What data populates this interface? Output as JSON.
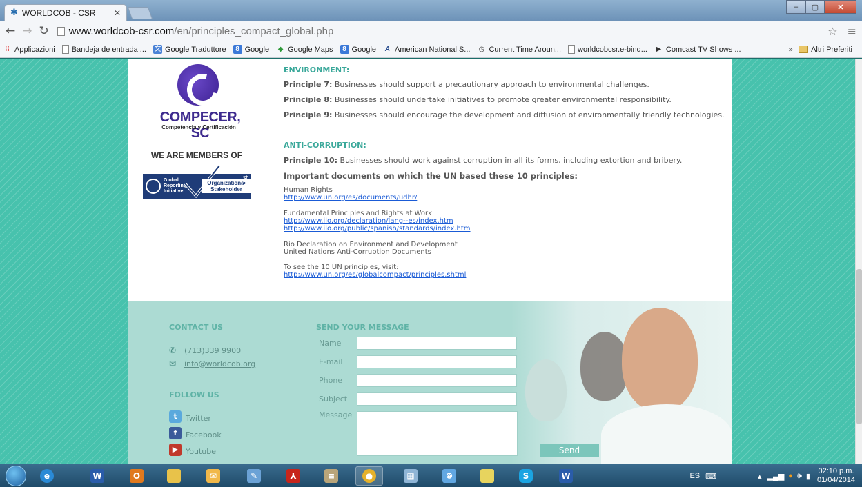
{
  "browser": {
    "tab_title": "WORLDCOB - CSR",
    "url_host": "www.worldcob-csr.com",
    "url_path": "/en/principles_compact_global.php",
    "bookmarks": [
      {
        "label": "Applicazioni",
        "icon": "apps-grid-icon"
      },
      {
        "label": "Bandeja de entrada ...",
        "icon": "page-icon"
      },
      {
        "label": "Google Traduttore",
        "icon": "translate-icon"
      },
      {
        "label": "Google",
        "icon": "google-icon"
      },
      {
        "label": "Google Maps",
        "icon": "maps-icon"
      },
      {
        "label": "Google",
        "icon": "google-icon"
      },
      {
        "label": "American National S...",
        "icon": "ans-icon"
      },
      {
        "label": "Current Time Aroun...",
        "icon": "clock-icon"
      },
      {
        "label": "worldcobcsr.e-bind...",
        "icon": "page-icon"
      },
      {
        "label": "Comcast TV Shows ...",
        "icon": "play-icon"
      }
    ],
    "bookmarks_more": "»",
    "other_bookmarks": "Altri Preferiti"
  },
  "sidebar": {
    "logo_name": "COMPECER, SC",
    "logo_sub": "Competencia y Certificación",
    "members_heading": "WE ARE MEMBERS OF",
    "gri_text": "Global Reporting Initiative",
    "gri_badge": "Organizational Stakeholder",
    "gri_year": "2014"
  },
  "main": {
    "environment_heading": "ENVIRONMENT:",
    "principles_env": [
      {
        "label": "Principle 7:",
        "text": " Businesses should support a precautionary approach to environmental challenges."
      },
      {
        "label": "Principle 8:",
        "text": " Businesses should undertake initiatives to promote greater environmental responsibility."
      },
      {
        "label": "Principle 9:",
        "text": " Businesses should encourage the development and diffusion of environmentally friendly technologies."
      }
    ],
    "anticorruption_heading": "ANTI-CORRUPTION:",
    "principle_10": {
      "label": "Principle 10:",
      "text": " Businesses should work against corruption in all its forms, including extortion and bribery."
    },
    "docs_title": "Important documents on which the UN based these 10 principles:",
    "doc_human_rights": "Human Rights",
    "link_udhr": "http://www.un.org/es/documents/udhr/",
    "doc_work": "Fundamental Principles and Rights at Work",
    "link_ilo_1": "http://www.ilo.org/declaration/lang--es/index.htm",
    "link_ilo_2": "http://www.ilo.org/public/spanish/standards/index.htm",
    "doc_rio": "Rio Declaration on Environment and Development",
    "doc_anticorruption": "United Nations Anti-Corruption Documents",
    "doc_visit": "To see the 10 UN principles, visit:",
    "link_principles": "http://www.un.org/es/globalcompact/principles.shtml"
  },
  "footer": {
    "contact_title": "CONTACT US",
    "phone": "(713)339 9900",
    "email": "info@worldcob.org",
    "follow_title": "FOLLOW US",
    "twitter": "Twitter",
    "facebook": "Facebook",
    "youtube": "Youtube",
    "form_title": "SEND YOUR MESSAGE",
    "label_name": "Name",
    "label_email": "E-mail",
    "label_phone": "Phone",
    "label_subject": "Subject",
    "label_message": "Message",
    "send_label": "Send"
  },
  "taskbar": {
    "language": "ES",
    "time": "02:10 p.m.",
    "date": "01/04/2014"
  },
  "colors": {
    "accent_teal": "#3aa89a",
    "link_blue": "#1a5bd6",
    "footer_bg": "#acdbd3",
    "page_bg": "#47c2ad"
  }
}
